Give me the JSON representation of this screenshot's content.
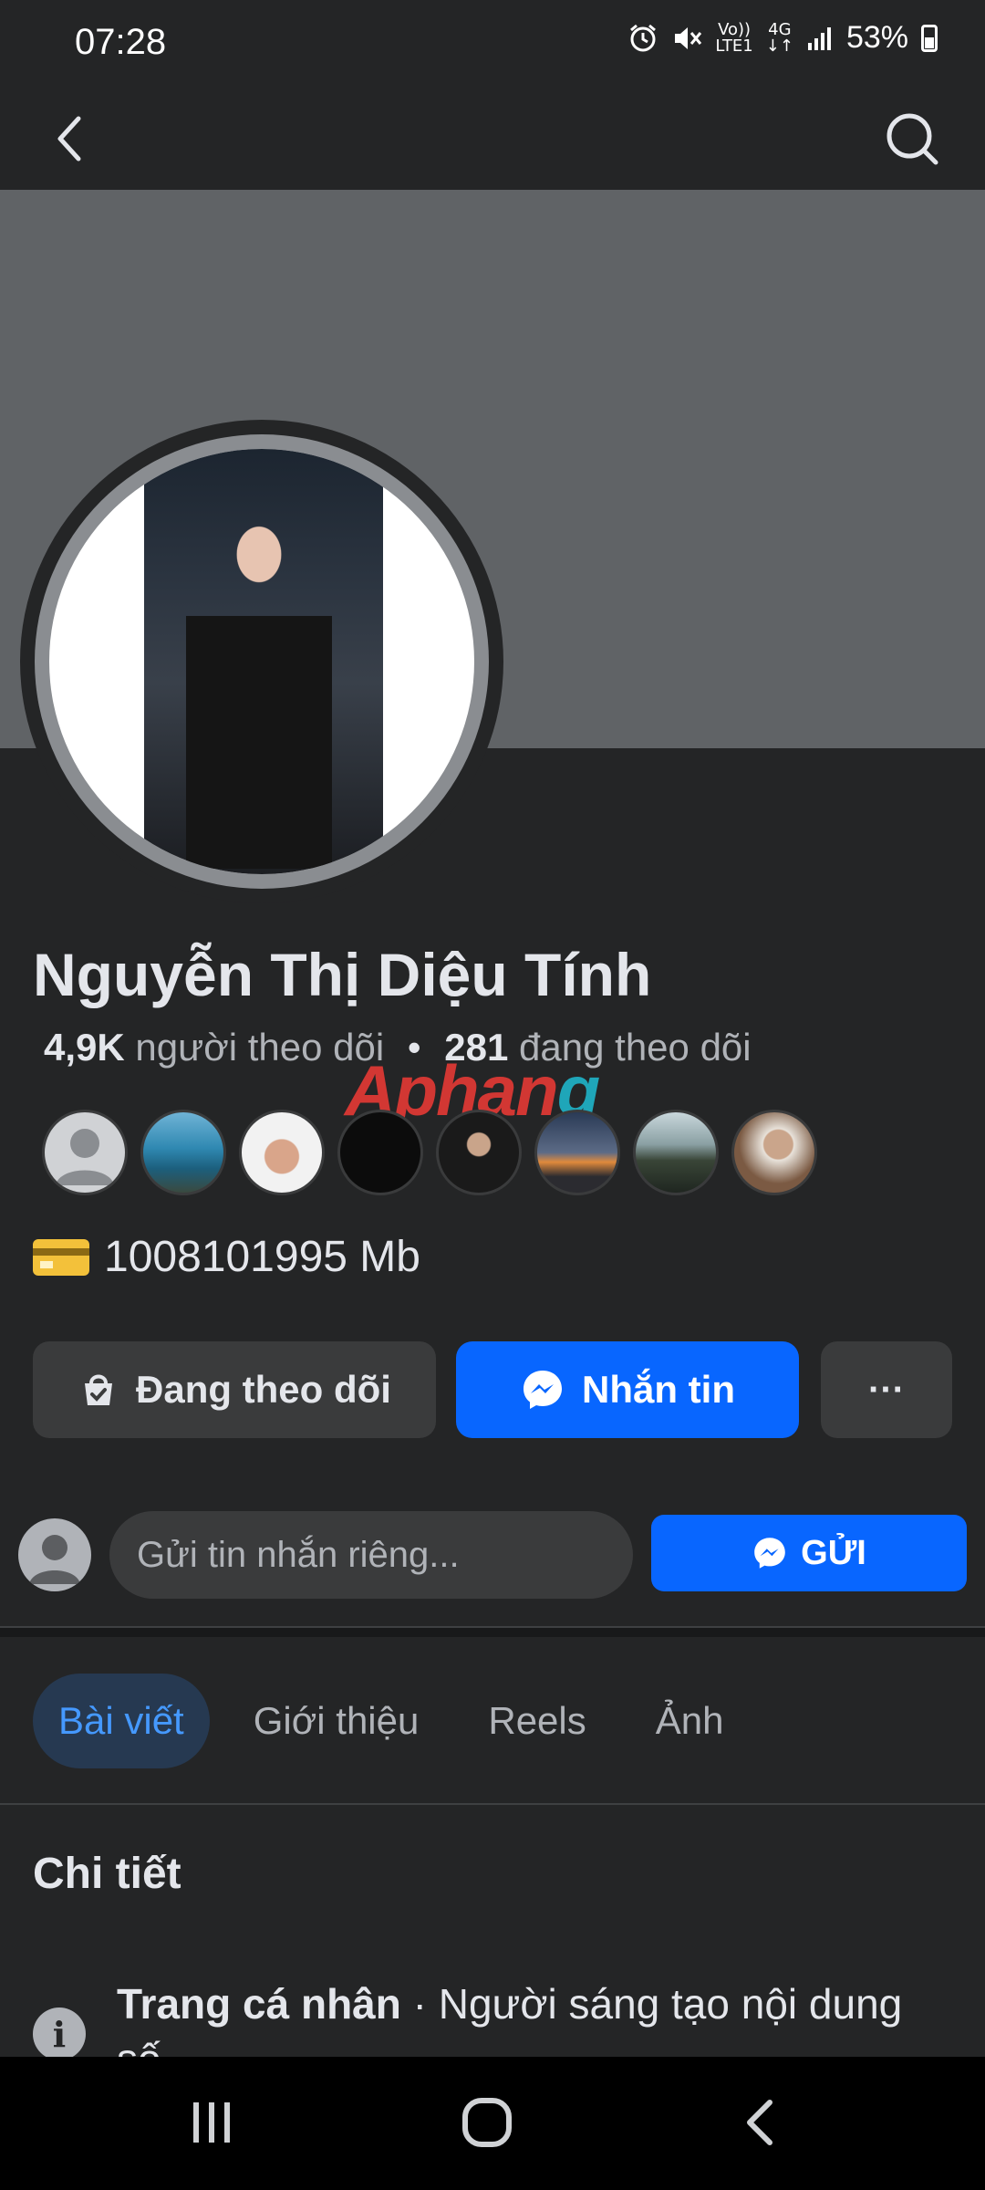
{
  "status_bar": {
    "time": "07:28",
    "network_top": "Vo))",
    "network_bottom": "LTE1",
    "generation": "4G",
    "battery": "53%"
  },
  "top_nav": {
    "back_icon": "back-arrow-icon",
    "search_icon": "search-icon"
  },
  "profile": {
    "name": "Nguyễn Thị Diệu Tính",
    "followers_count": "4,9K",
    "followers_label": "người theo dõi",
    "separator": "•",
    "following_count": "281",
    "following_label": "đang theo dõi",
    "info_text": "1008101995 Mb"
  },
  "watermark": {
    "part1": "Aphan",
    "part2": "g"
  },
  "actions": {
    "follow_label": "Đang theo dõi",
    "message_label": "Nhắn tin",
    "more_label": "···"
  },
  "private_message": {
    "placeholder": "Gửi tin nhắn riêng...",
    "send_label": "GỬI"
  },
  "tabs": [
    {
      "label": "Bài viết",
      "active": true
    },
    {
      "label": "Giới thiệu",
      "active": false
    },
    {
      "label": "Reels",
      "active": false
    },
    {
      "label": "Ảnh",
      "active": false
    }
  ],
  "details": {
    "title": "Chi tiết",
    "category_bold": "Trang cá nhân",
    "category_rest": " · Người sáng tạo nội dung số"
  },
  "colors": {
    "accent": "#0866ff",
    "background": "#242526",
    "cover": "#606366"
  }
}
